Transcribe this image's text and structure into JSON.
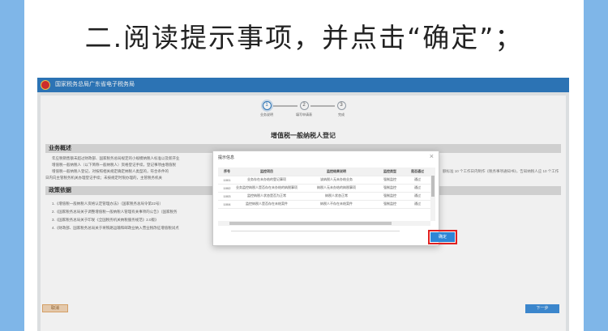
{
  "caption": "二.阅读提示事项，并点击“确定”；",
  "app": {
    "title": "国家税务总局广东省电子税务局"
  },
  "steps": [
    {
      "num": "1",
      "label": "业务说明"
    },
    {
      "num": "2",
      "label": "填写申请表"
    },
    {
      "num": "3",
      "label": "完成"
    }
  ],
  "form": {
    "title": "增值税一般纳税人登记",
    "business_heading": "业务概述",
    "business_lines": [
      "年应税销售额未超过财政部、国家税务总局规定的小规模纳税人标准以及新开业",
      "增值税一般纳税人（以下简称一般纳税人）资格登记手续，登记事项由增值税",
      "增值税一般纳税人登记，对按照相关规定确定纳税人类型的，符合条件的",
      "日内向主管税务机关办理登记手续；未按规定时限办理的，主管税务机关"
    ],
    "business_right_1": "额标准 10 个工作日内制作《税务事项通知书》，告知纳税人应 10 个工作",
    "business_right_2": "",
    "policy_heading": "政策依据",
    "policy_lines": [
      "1.《增值税一般纳税人资格认定管理办法》（国家税务总局令第22号）",
      "2.《国家税务总局关于调整增值税一般纳税人管理有关事项的公告》（国家税务",
      "3.《国家税务总局关于印发《全国税务机关纳税服务规范》2.0版》",
      "4.《财政部、国家税务总局关于将铁路运输和邮政业纳入营业税改征增值税试点"
    ],
    "cancel_label": "取消",
    "next_label": "下一步"
  },
  "modal": {
    "title": "提示信息",
    "close": "×",
    "columns": [
      "序号",
      "监控项目",
      "监控结果说明",
      "监控类型",
      "是否通过"
    ],
    "rows": [
      [
        "1001",
        "业务存在未办结的登记事项",
        "该纳税人无未办结业务",
        "强制监控",
        "通过"
      ],
      [
        "1002",
        "业务监控纳税人是否存在未办结的纳税事项",
        "纳税人无未办结的纳税事项",
        "强制监控",
        "通过"
      ],
      [
        "1003",
        "监控纳税人状态是否为正常",
        "纳税人状态正常",
        "强制监控",
        "通过"
      ],
      [
        "1004",
        "监控纳税人是否存在未结案件",
        "纳税人不存在未结案件",
        "强制监控",
        "通过"
      ]
    ],
    "ok_label": "确定"
  }
}
